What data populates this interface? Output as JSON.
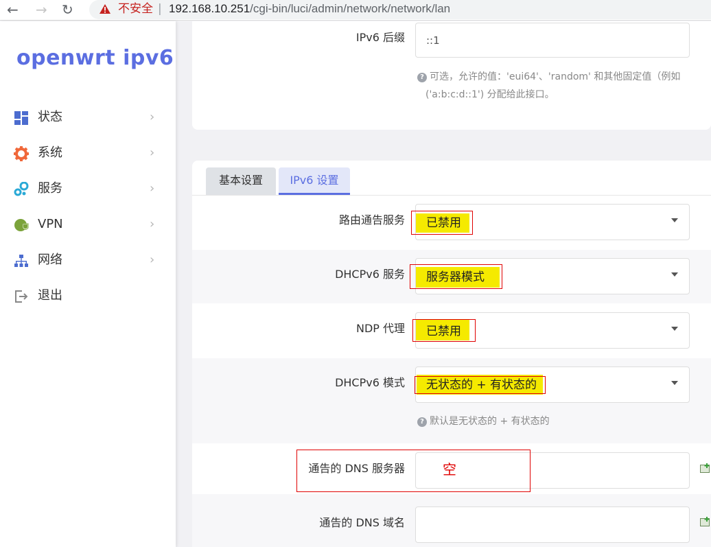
{
  "browser": {
    "insecure_label": "不安全",
    "url_host": "192.168.10.251",
    "url_path": "/cgi-bin/luci/admin/network/network/lan"
  },
  "sidebar": {
    "brand": "openwrt ipv6",
    "items": [
      {
        "label": "状态",
        "icon": "dashboard-icon"
      },
      {
        "label": "系统",
        "icon": "gear-icon"
      },
      {
        "label": "服务",
        "icon": "services-icon"
      },
      {
        "label": "VPN",
        "icon": "vpn-shield-icon"
      },
      {
        "label": "网络",
        "icon": "network-icon"
      },
      {
        "label": "退出",
        "icon": "logout-icon"
      }
    ]
  },
  "top_section": {
    "ipv6_suffix_label": "IPv6 后缀",
    "ipv6_suffix_value": "::1",
    "ipv6_suffix_hint_line1": "可选，允许的值：'eui64'、'random' 和其他固定值（例如",
    "ipv6_suffix_hint_line2": "('a:b:c:d::1') 分配给此接口。"
  },
  "tabs": [
    {
      "label": "基本设置",
      "active": false
    },
    {
      "label": "IPv6 设置",
      "active": true
    }
  ],
  "fields": {
    "ra_service": {
      "label": "路由通告服务",
      "value": "已禁用"
    },
    "dhcpv6_service": {
      "label": "DHCPv6 服务",
      "value": "服务器模式"
    },
    "ndp_proxy": {
      "label": "NDP 代理",
      "value": "已禁用"
    },
    "dhcpv6_mode": {
      "label": "DHCPv6 模式",
      "value": "无状态的 + 有状态的",
      "hint": "默认是无状态的 + 有状态的"
    },
    "announced_dns_servers": {
      "label": "通告的 DNS 服务器",
      "value": ""
    },
    "announced_dns_domains": {
      "label": "通告的 DNS 域名",
      "value": ""
    }
  },
  "annotation": {
    "empty_note": "空"
  },
  "colors": {
    "accent": "#5b6ee1",
    "highlight": "#f5ea00",
    "annotation_red": "#e00000"
  }
}
